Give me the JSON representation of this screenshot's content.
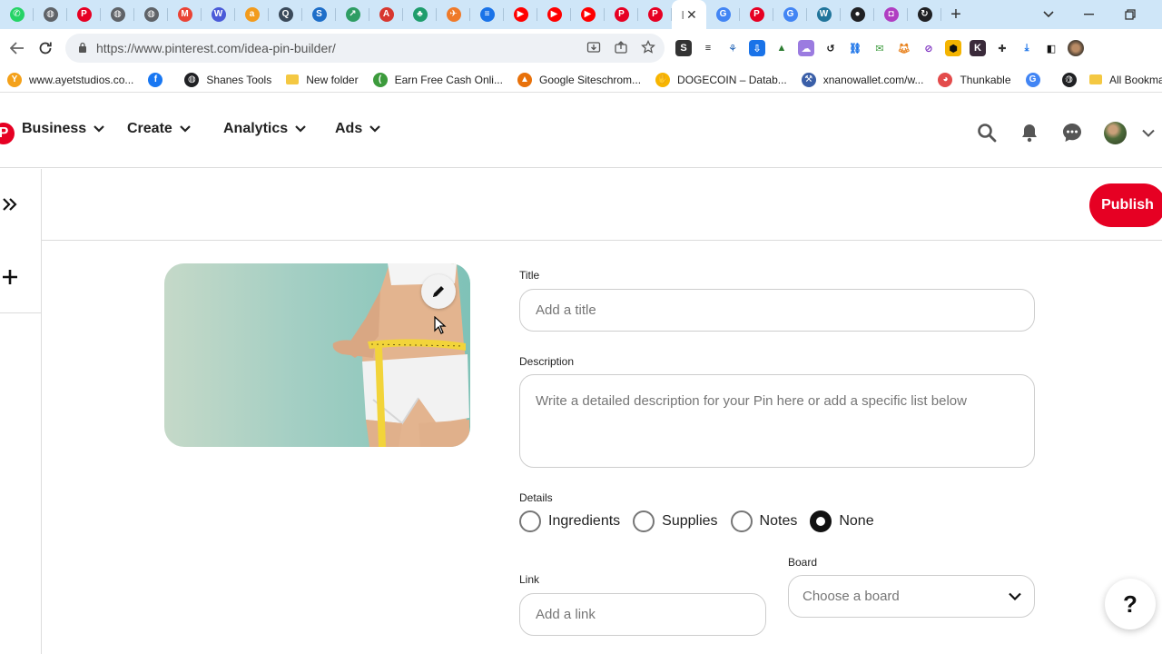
{
  "browser": {
    "tabs": [
      {
        "name": "whatsapp",
        "color": "#25d366",
        "glyph": "✆"
      },
      {
        "name": "globe",
        "color": "#5f6368",
        "glyph": "◍"
      },
      {
        "name": "pinterest",
        "color": "#e60023",
        "glyph": "P"
      },
      {
        "name": "globe",
        "color": "#5f6368",
        "glyph": "◍"
      },
      {
        "name": "globe",
        "color": "#5f6368",
        "glyph": "◍"
      },
      {
        "name": "gmail",
        "color": "#ea4335",
        "glyph": "M"
      },
      {
        "name": "wand",
        "color": "#4a5bd8",
        "glyph": "W"
      },
      {
        "name": "amazon",
        "color": "#f29b1d",
        "glyph": "a"
      },
      {
        "name": "search-lens",
        "color": "#3b4a5a",
        "glyph": "Q"
      },
      {
        "name": "app-blue",
        "color": "#1e6ec8",
        "glyph": "S"
      },
      {
        "name": "chart",
        "color": "#2e9d63",
        "glyph": "↗"
      },
      {
        "name": "adobe",
        "color": "#d7372f",
        "glyph": "A"
      },
      {
        "name": "leaf",
        "color": "#1f9d6c",
        "glyph": "♣"
      },
      {
        "name": "rocket",
        "color": "#ef7a2a",
        "glyph": "✈"
      },
      {
        "name": "docs",
        "color": "#1a73e8",
        "glyph": "≡"
      },
      {
        "name": "youtube",
        "color": "#ff0000",
        "glyph": "▶"
      },
      {
        "name": "youtube",
        "color": "#ff0000",
        "glyph": "▶"
      },
      {
        "name": "youtube",
        "color": "#ff0000",
        "glyph": "▶"
      },
      {
        "name": "pinterest",
        "color": "#e60023",
        "glyph": "P"
      },
      {
        "name": "pinterest",
        "color": "#e60023",
        "glyph": "P"
      }
    ],
    "active_tab": {
      "glyph": "I",
      "close": "✕"
    },
    "tabs_after": [
      {
        "name": "google",
        "color": "#4285f4",
        "glyph": "G"
      },
      {
        "name": "pinterest",
        "color": "#e60023",
        "glyph": "P"
      },
      {
        "name": "google",
        "color": "#4285f4",
        "glyph": "G"
      },
      {
        "name": "wordpress",
        "color": "#21759b",
        "glyph": "W"
      },
      {
        "name": "circle-app",
        "color": "#202124",
        "glyph": "●"
      },
      {
        "name": "camera-app",
        "color": "#b03ec2",
        "glyph": "◘"
      },
      {
        "name": "loading",
        "color": "#202124",
        "glyph": "↻"
      }
    ],
    "new_tab": "+",
    "url": "https://www.pinterest.com/idea-pin-builder/",
    "bookmarks": [
      {
        "label": "www.ayetstudios.co...",
        "color": "#f4a11a",
        "glyph": "Y"
      },
      {
        "label": "",
        "color": "#1877f2",
        "glyph": "f"
      },
      {
        "label": "Shanes Tools",
        "color": "#202124",
        "glyph": "◍"
      },
      {
        "label": "New folder",
        "folder": true
      },
      {
        "label": "Earn Free Cash Onli...",
        "color": "#3c9b3c",
        "glyph": "("
      },
      {
        "label": "Google Siteschrom...",
        "color": "#e8710a",
        "glyph": "▲"
      },
      {
        "label": "DOGECOIN – Datab...",
        "color": "#f7b500",
        "glyph": "✋"
      },
      {
        "label": "xnanowallet.com/w...",
        "color": "#3a5fa8",
        "glyph": "⚒"
      },
      {
        "label": "Thunkable",
        "color": "#e34b4b",
        "glyph": "◕"
      },
      {
        "label": "",
        "color": "#4285f4",
        "glyph": "G"
      },
      {
        "label": "",
        "color": "#202124",
        "glyph": "◍"
      }
    ],
    "bookmarks_more": "»",
    "all_bookmarks": "All Bookma"
  },
  "header": {
    "logo_glyph": "P",
    "menu": [
      {
        "label": "Business"
      },
      {
        "label": "Create"
      },
      {
        "label": "Analytics"
      },
      {
        "label": "Ads"
      }
    ]
  },
  "rail": {
    "expand": "»",
    "add": "+"
  },
  "toolbar": {
    "publish_label": "Publish"
  },
  "form": {
    "title_label": "Title",
    "title_placeholder": "Add a title",
    "description_label": "Description",
    "description_placeholder": "Write a detailed description for your Pin here or add a specific list below",
    "details_label": "Details",
    "details_options": [
      {
        "label": "Ingredients",
        "selected": false
      },
      {
        "label": "Supplies",
        "selected": false
      },
      {
        "label": "Notes",
        "selected": false
      },
      {
        "label": "None",
        "selected": true
      }
    ],
    "link_label": "Link",
    "link_placeholder": "Add a link",
    "board_label": "Board",
    "board_placeholder": "Choose a board"
  },
  "help_label": "?",
  "colors": {
    "accent": "#e60023",
    "tabstrip": "#cfe6f8"
  }
}
